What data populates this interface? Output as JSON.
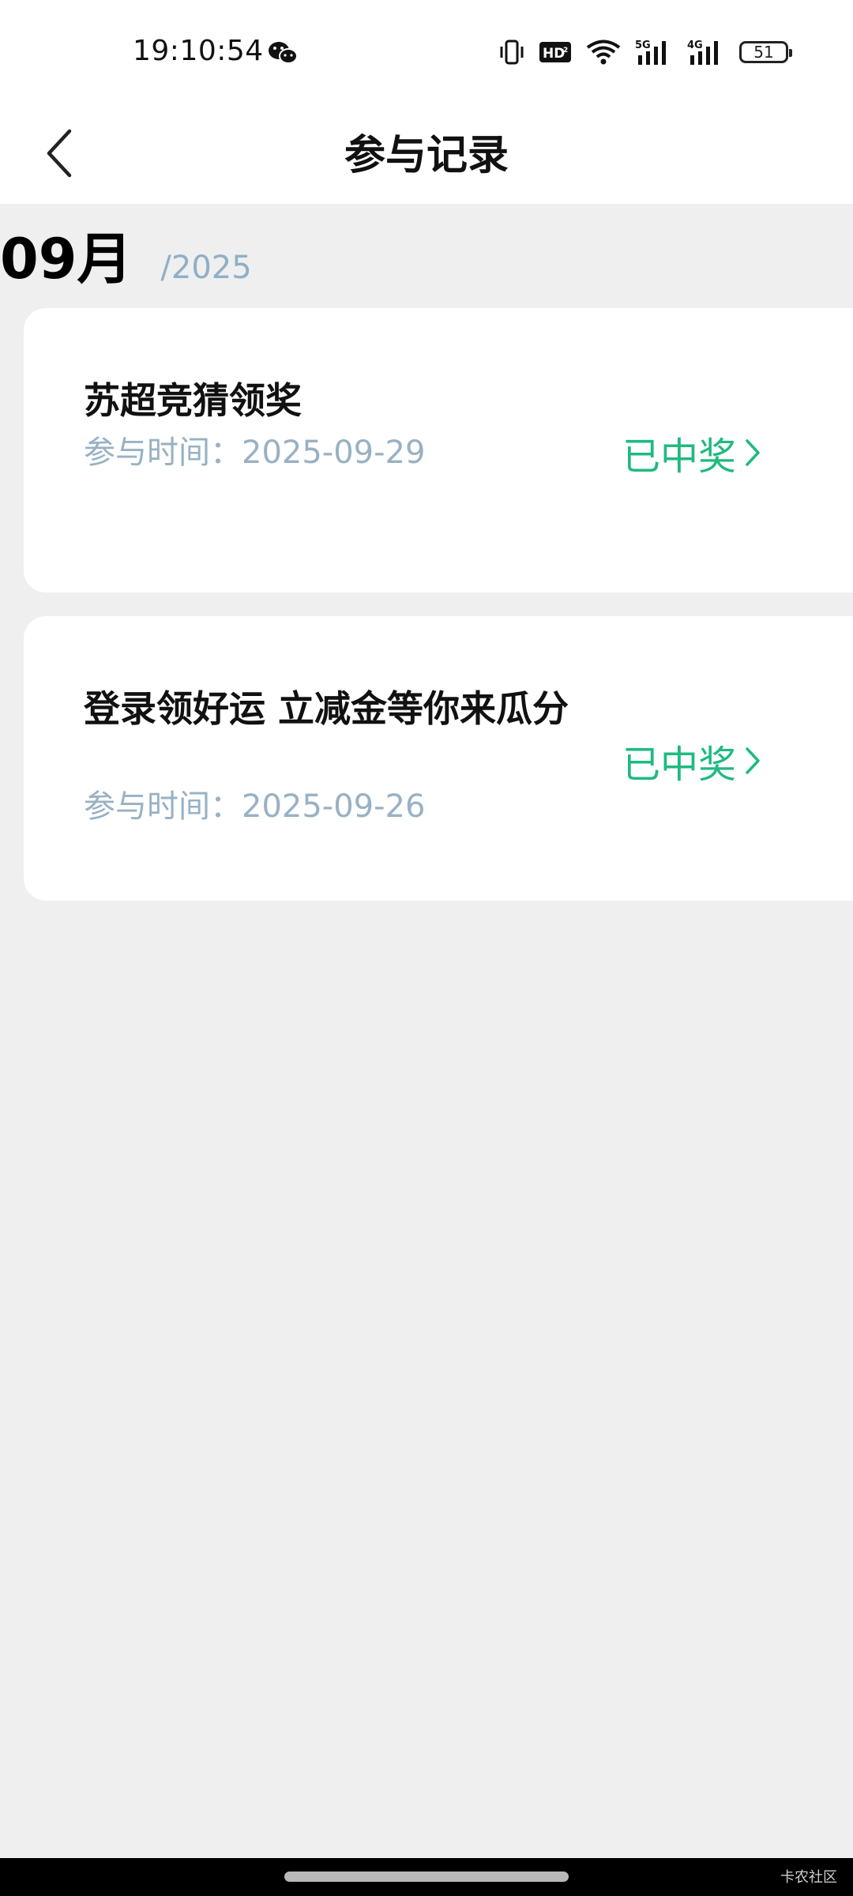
{
  "status_bar": {
    "time": "19:10:54",
    "battery_level": "51",
    "icons": [
      "wechat-icon",
      "vibrate-icon",
      "hd-icon",
      "wifi-icon",
      "5g-signal-icon",
      "4g-signal-icon",
      "battery-icon"
    ]
  },
  "header": {
    "title": "参与记录",
    "back_icon": "chevron-left-icon"
  },
  "month_group": {
    "month": "09月",
    "year": "/2025"
  },
  "records": [
    {
      "title": "苏超竞猜领奖",
      "date_label": "参与时间：2025-09-29",
      "status": "已中奖"
    },
    {
      "title": "登录领好运 立减金等你来瓜分",
      "date_label": "参与时间：2025-09-26",
      "status": "已中奖"
    }
  ],
  "colors": {
    "status_green": "#1fba7f",
    "secondary_text": "#98b1c4",
    "background": "#efefef"
  },
  "watermark": "卡农社区"
}
